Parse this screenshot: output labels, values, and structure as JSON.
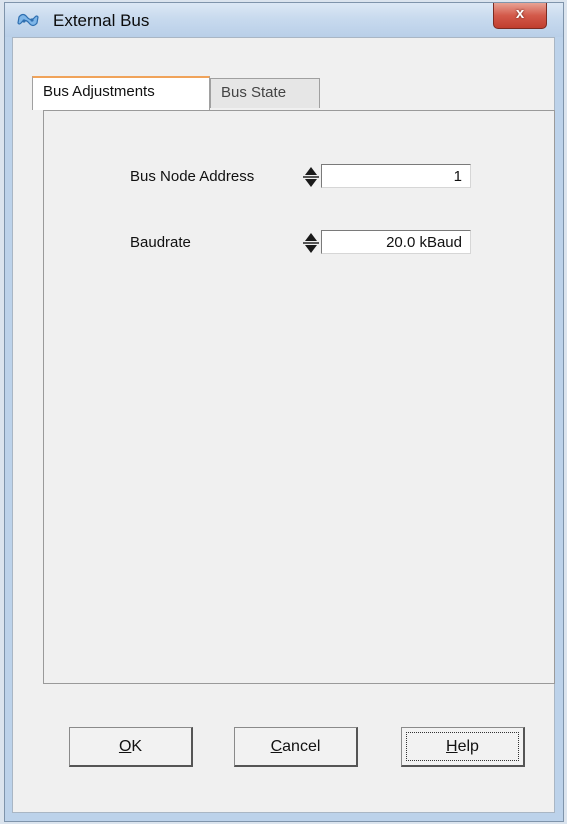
{
  "window": {
    "title": "External Bus",
    "close_label": "x"
  },
  "tabs": [
    {
      "label": "Bus Adjustments",
      "active": true
    },
    {
      "label": "Bus State",
      "active": false
    }
  ],
  "fields": {
    "bus_node_address": {
      "label": "Bus Node Address",
      "value": "1"
    },
    "baudrate": {
      "label": "Baudrate",
      "value": "20.0 kBaud"
    }
  },
  "buttons": {
    "ok": {
      "mnemonic": "O",
      "rest": "K"
    },
    "cancel": {
      "mnemonic": "C",
      "rest": "ancel"
    },
    "help": {
      "mnemonic": "H",
      "rest": "elp"
    }
  },
  "icons": {
    "app": "app-logo-icon",
    "spin": "spin-arrows-icon",
    "close": "close-icon"
  },
  "colors": {
    "close_button": "#c9473a",
    "active_tab_accent": "#f0a35a",
    "titlebar": "#c8daee"
  }
}
